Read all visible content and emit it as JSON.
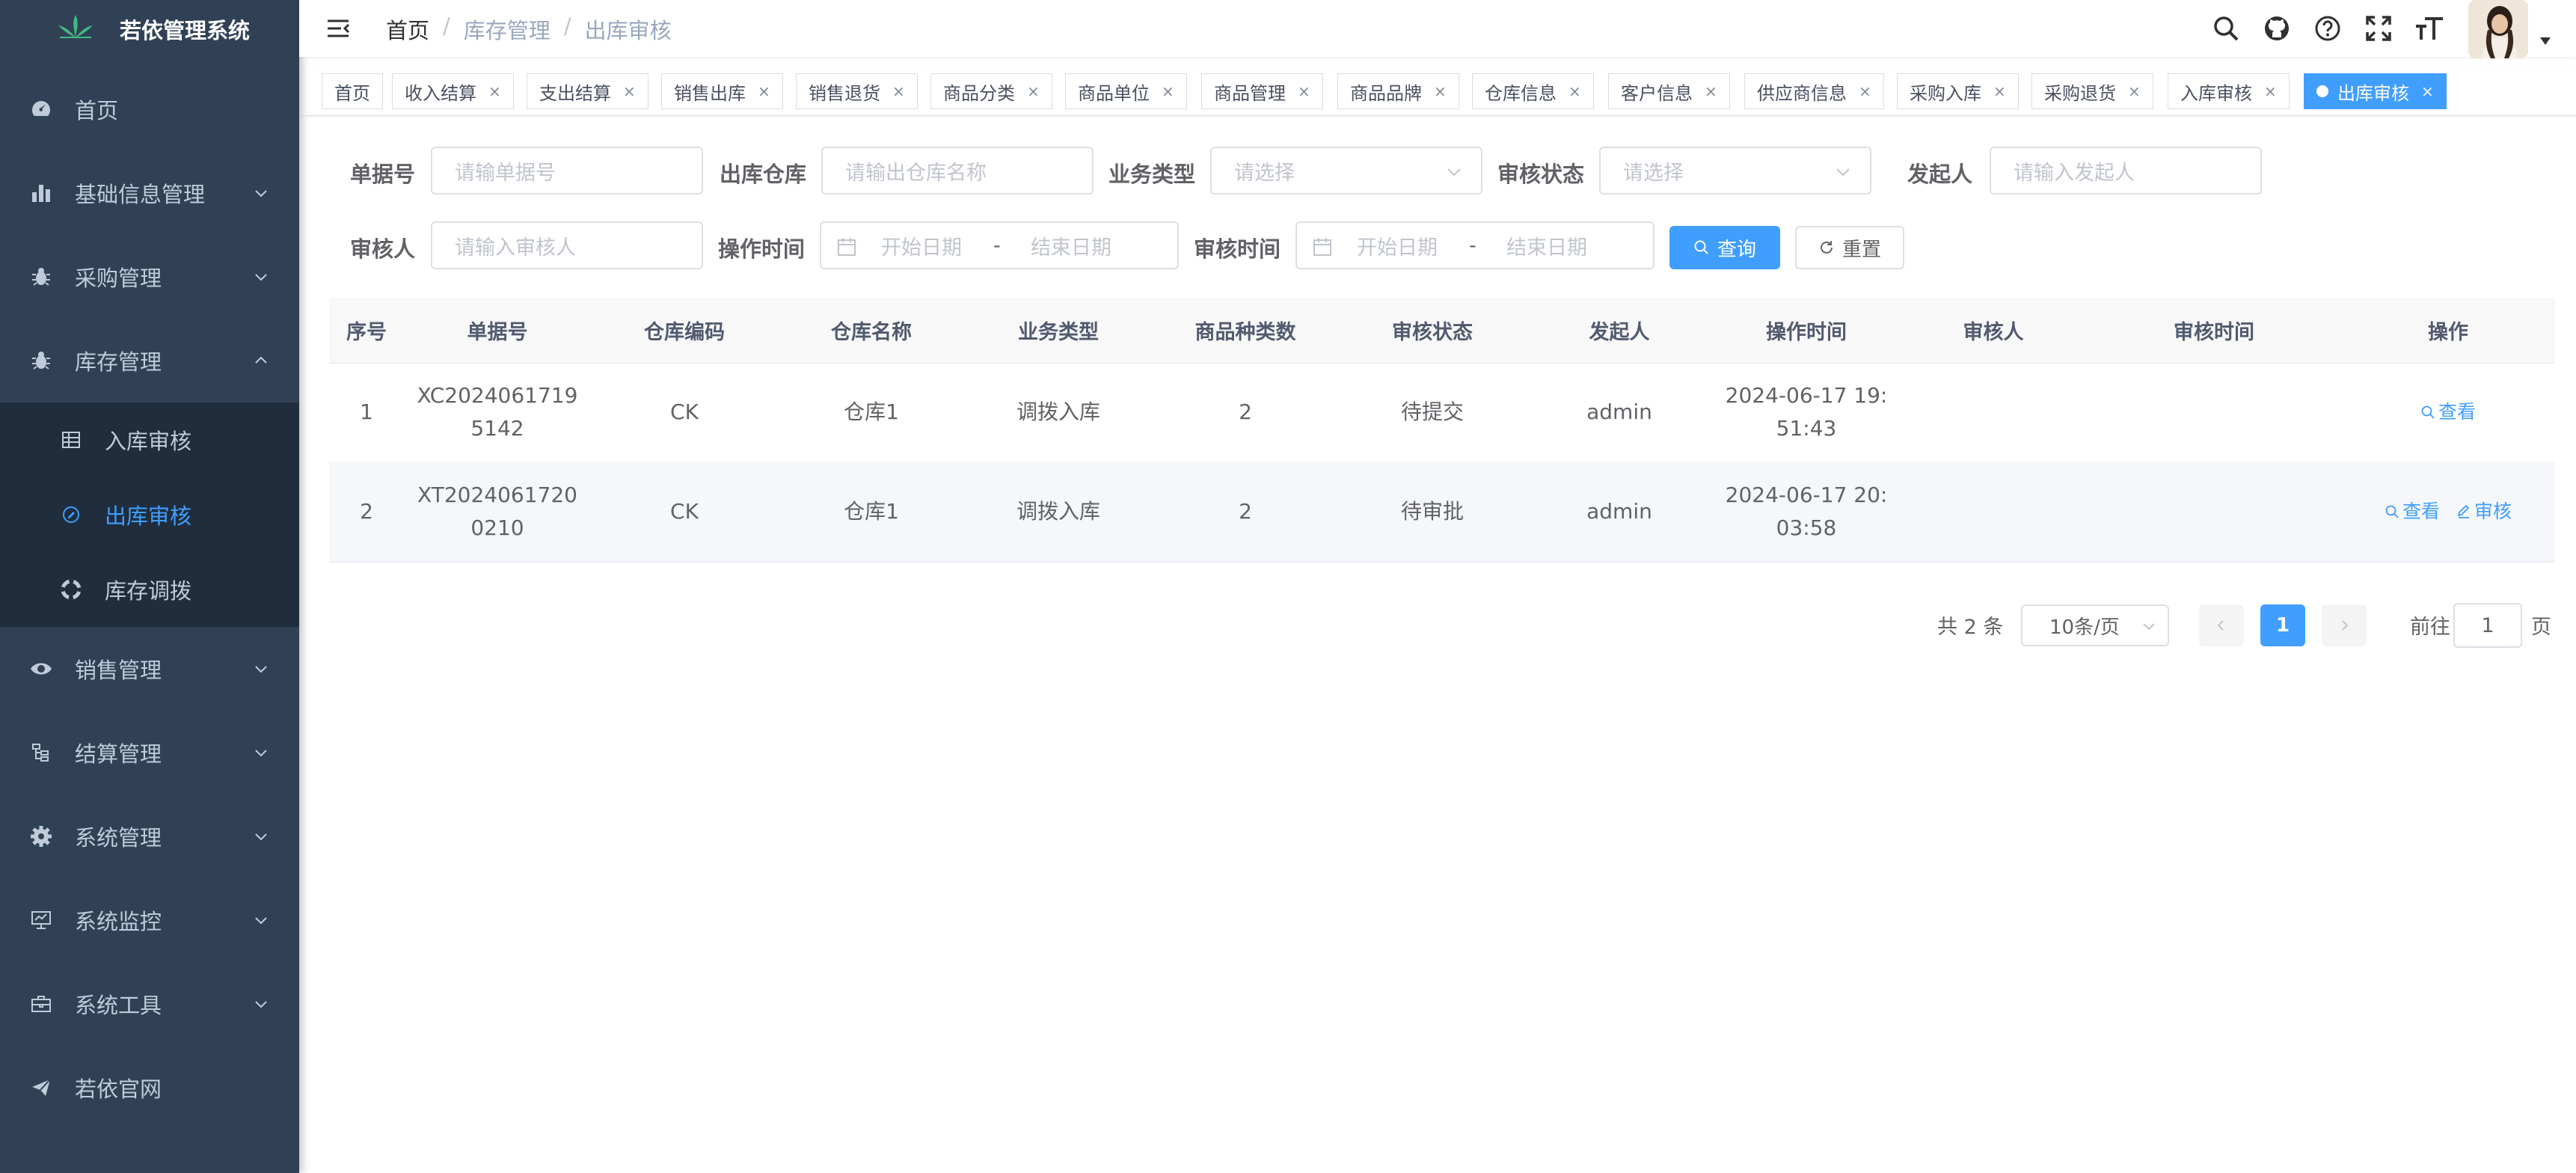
{
  "app": {
    "title": "若依管理系统"
  },
  "sidebar": {
    "items": [
      {
        "label": "首页"
      },
      {
        "label": "基础信息管理"
      },
      {
        "label": "采购管理"
      },
      {
        "label": "库存管理"
      },
      {
        "label": "销售管理"
      },
      {
        "label": "结算管理"
      },
      {
        "label": "系统管理"
      },
      {
        "label": "系统监控"
      },
      {
        "label": "系统工具"
      },
      {
        "label": "若依官网"
      }
    ],
    "submenu": [
      {
        "label": "入库审核"
      },
      {
        "label": "出库审核"
      },
      {
        "label": "库存调拨"
      }
    ]
  },
  "navbar": {
    "breadcrumb": [
      "首页",
      "库存管理",
      "出库审核"
    ],
    "separator": "/"
  },
  "tags": [
    {
      "label": "首页"
    },
    {
      "label": "收入结算",
      "close": "×"
    },
    {
      "label": "支出结算",
      "close": "×"
    },
    {
      "label": "销售出库",
      "close": "×"
    },
    {
      "label": "销售退货",
      "close": "×"
    },
    {
      "label": "商品分类",
      "close": "×"
    },
    {
      "label": "商品单位",
      "close": "×"
    },
    {
      "label": "商品管理",
      "close": "×"
    },
    {
      "label": "商品品牌",
      "close": "×"
    },
    {
      "label": "仓库信息",
      "close": "×"
    },
    {
      "label": "客户信息",
      "close": "×"
    },
    {
      "label": "供应商信息",
      "close": "×"
    },
    {
      "label": "采购入库",
      "close": "×"
    },
    {
      "label": "采购退货",
      "close": "×"
    },
    {
      "label": "入库审核",
      "close": "×"
    },
    {
      "label": "出库审核",
      "close": "×",
      "active": true
    }
  ],
  "filters": {
    "doc_no": {
      "label": "单据号",
      "placeholder": "请输单据号"
    },
    "out_warehouse": {
      "label": "出库仓库",
      "placeholder": "请输出仓库名称"
    },
    "biz_type": {
      "label": "业务类型",
      "placeholder": "请选择"
    },
    "audit_status": {
      "label": "审核状态",
      "placeholder": "请选择"
    },
    "initiator": {
      "label": "发起人",
      "placeholder": "请输入发起人"
    },
    "auditor": {
      "label": "审核人",
      "placeholder": "请输入审核人"
    },
    "op_time": {
      "label": "操作时间",
      "start": "开始日期",
      "sep": "-",
      "end": "结束日期"
    },
    "audit_time": {
      "label": "审核时间",
      "start": "开始日期",
      "sep": "-",
      "end": "结束日期"
    },
    "search_btn": "查询",
    "reset_btn": "重置"
  },
  "table": {
    "columns": [
      "序号",
      "单据号",
      "仓库编码",
      "仓库名称",
      "业务类型",
      "商品种类数",
      "审核状态",
      "发起人",
      "操作时间",
      "审核人",
      "审核时间",
      "操作"
    ],
    "rows": [
      {
        "idx": "1",
        "doc_no": "XC20240617195142",
        "wh_code": "CK",
        "wh_name": "仓库1",
        "biz_type": "调拨入库",
        "kinds": "2",
        "status": "待提交",
        "initiator": "admin",
        "op_time": "2024-06-17 19:51:43",
        "auditor": "",
        "audit_time": "",
        "actions": [
          "查看"
        ]
      },
      {
        "idx": "2",
        "doc_no": "XT20240617200210",
        "wh_code": "CK",
        "wh_name": "仓库1",
        "biz_type": "调拨入库",
        "kinds": "2",
        "status": "待审批",
        "initiator": "admin",
        "op_time": "2024-06-17 20:03:58",
        "auditor": "",
        "audit_time": "",
        "actions": [
          "查看",
          "审核"
        ]
      }
    ]
  },
  "pagination": {
    "total": "共 2 条",
    "page_size": "10条/页",
    "current": "1",
    "goto_label": "前往",
    "goto_value": "1",
    "goto_suffix": "页"
  },
  "colors": {
    "sidebar_bg": "#304156",
    "submenu_bg": "#1f2d3d",
    "primary": "#409eff"
  }
}
